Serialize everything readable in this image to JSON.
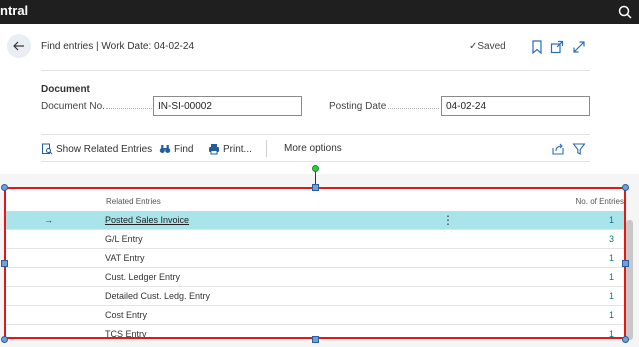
{
  "topbar": {
    "brand": "ntral"
  },
  "header": {
    "title": "Find entries | Work Date: 04-02-24",
    "saved": "Saved"
  },
  "document": {
    "section": "Document",
    "doc_no_label": "Document No.",
    "doc_no_value": "IN-SI-00002",
    "posting_date_label": "Posting Date",
    "posting_date_value": "04-02-24"
  },
  "actions": {
    "show_related": "Show Related Entries",
    "find": "Find",
    "print": "Print...",
    "more": "More options"
  },
  "list": {
    "col_related": "Related Entries",
    "col_count": "No. of Entries",
    "rows": [
      {
        "name": "Posted Sales Invoice",
        "count": "1"
      },
      {
        "name": "G/L Entry",
        "count": "3"
      },
      {
        "name": "VAT Entry",
        "count": "1"
      },
      {
        "name": "Cust. Ledger Entry",
        "count": "1"
      },
      {
        "name": "Detailed Cust. Ledg. Entry",
        "count": "1"
      },
      {
        "name": "Cost Entry",
        "count": "1"
      },
      {
        "name": "TCS Entry",
        "count": "1"
      }
    ]
  },
  "colors": {
    "selected_row": "#a8e4ea",
    "accent": "#007a87",
    "frame": "#e01818"
  }
}
